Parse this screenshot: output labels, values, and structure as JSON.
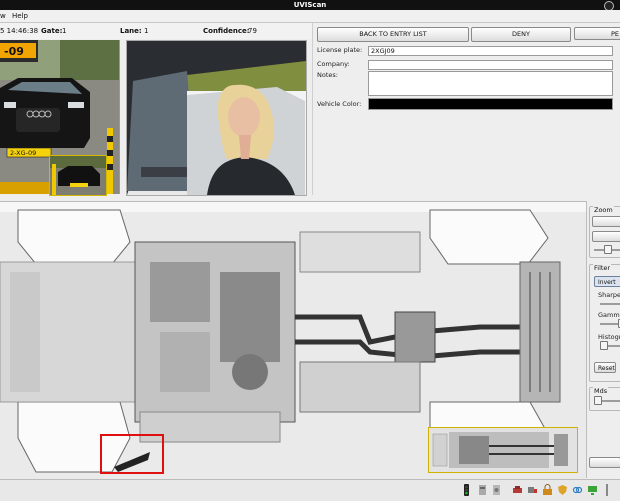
{
  "window": {
    "title": "UVIScan"
  },
  "menu": {
    "items": [
      "w",
      "Help"
    ]
  },
  "info": {
    "datetime": "5 14:46:38",
    "gate_label": "Gate:",
    "gate_value": "1",
    "lane_label": "Lane:",
    "lane_value": "1",
    "confidence_label": "Confidence:",
    "confidence_value": "79"
  },
  "photo": {
    "plate_sign": "-09",
    "car_plate": "2-XG-09"
  },
  "actions": {
    "back_label": "BACK TO ENTRY LIST",
    "deny_label": "DENY",
    "third_label": "PE"
  },
  "form": {
    "license_plate_label": "License plate:",
    "license_plate_value": "2XGJ09",
    "company_label": "Company:",
    "company_value": "",
    "notes_label": "Notes:",
    "notes_value": "",
    "vehicle_color_label": "Vehicle Color:",
    "vehicle_color": "#000000"
  },
  "side": {
    "zoom_title": "Zoom",
    "filter_title": "Filter",
    "invert_label": "Invert",
    "sharpen_label": "Sharpe",
    "gamma_label": "Gamma",
    "histogram_label": "Histogr",
    "reset_label": "Reset",
    "mds_title": "Mds"
  },
  "colors": {
    "titlebar": "#111111",
    "alert_box": "#e01010",
    "thumb_border": "#d2b200"
  },
  "status_icons": [
    "traffic-light-icon",
    "barrier-icon",
    "camera-icon",
    "car-icon",
    "truck-icon",
    "lock-icon",
    "shield-icon",
    "link-icon",
    "monitor-icon",
    "warning-icon",
    "separator-icon"
  ]
}
